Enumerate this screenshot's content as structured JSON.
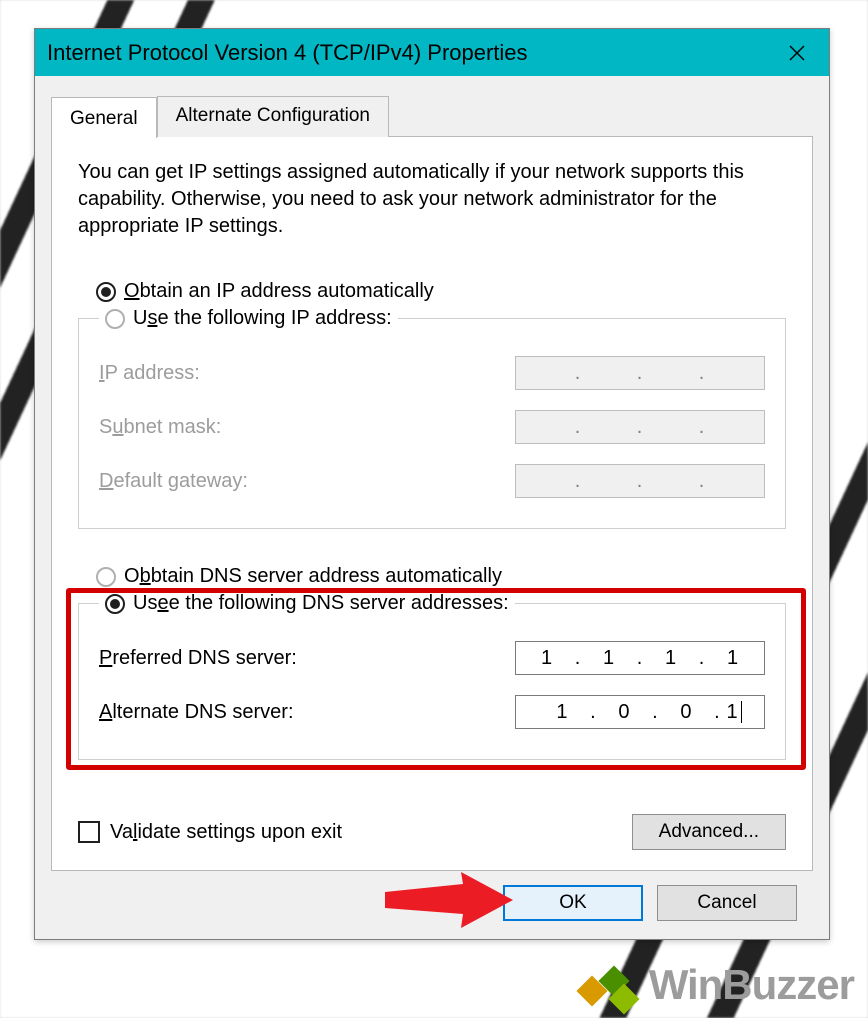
{
  "window": {
    "title": "Internet Protocol Version 4 (TCP/IPv4) Properties"
  },
  "tabs": {
    "general": "General",
    "alternate": "Alternate Configuration"
  },
  "intro": "You can get IP settings assigned automatically if your network supports this capability. Otherwise, you need to ask your network administrator for the appropriate IP settings.",
  "ip": {
    "obtain_auto": "btain an IP address automatically",
    "use_following": "e the following IP address:",
    "ip_address_lbl": "P address:",
    "subnet_lbl": "bnet mask:",
    "gateway_lbl": "efault gateway:"
  },
  "dns": {
    "obtain_auto": "btain DNS server address automatically",
    "use_following": "e the following DNS server addresses:",
    "preferred_lbl": "referred DNS server:",
    "alternate_lbl": "lternate DNS server:",
    "preferred_value": [
      "1",
      "1",
      "1",
      "1"
    ],
    "alternate_value": [
      "1",
      "0",
      "0",
      "1"
    ]
  },
  "validate": "idate settings upon exit",
  "buttons": {
    "advanced": "Advanced...",
    "ok": "OK",
    "cancel": "Cancel"
  },
  "watermark": "WinBuzzer"
}
